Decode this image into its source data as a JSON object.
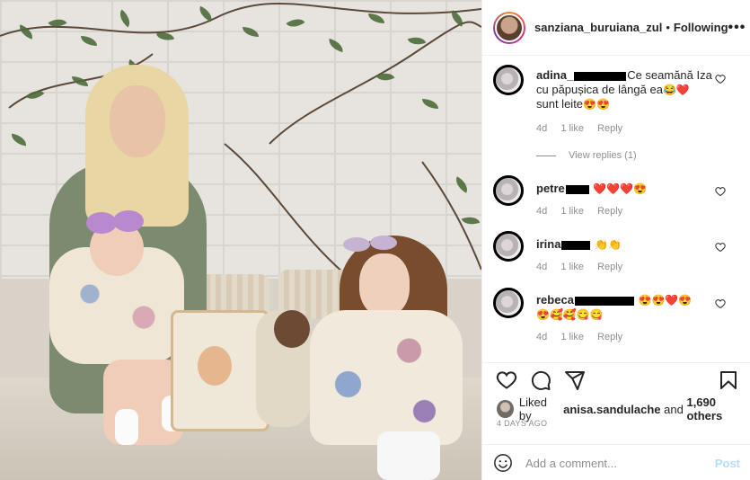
{
  "post": {
    "username": "sanziana_buruiana_zul",
    "separator": "•",
    "follow_status": "Following",
    "more_label": "•••"
  },
  "comments": [
    {
      "user": "adina_",
      "text_line1": "Ce seamănă Iza",
      "text_line2": "cu păpușica de lângă ea",
      "emoji_line2": "😂❤️",
      "text_line3": "sunt leite",
      "emoji_line3": "😍😍",
      "age": "4d",
      "likes": "1 like",
      "reply": "Reply",
      "like_icon": "heart-outline-icon"
    },
    {
      "user": "petre",
      "text": "",
      "emoji": "❤️❤️❤️😍",
      "age": "4d",
      "likes": "1 like",
      "reply": "Reply",
      "like_icon": "heart-outline-icon"
    },
    {
      "user": "irina",
      "text": "",
      "emoji": "👏👏",
      "age": "4d",
      "likes": "1 like",
      "reply": "Reply",
      "like_icon": "heart-outline-icon"
    },
    {
      "user": "rebeca",
      "emoji_line1": "😍😍❤️😍",
      "emoji_line2": "😍🥰🥰😋😋",
      "age": "4d",
      "likes": "1 like",
      "reply": "Reply",
      "like_icon": "heart-outline-icon"
    }
  ],
  "view_replies": "View replies (1)",
  "actions": {
    "like_icon": "heart-icon",
    "comment_icon": "comment-icon",
    "share_icon": "share-icon",
    "save_icon": "bookmark-icon"
  },
  "likes": {
    "prefix": "Liked by",
    "user": "anisa.sandulache",
    "middle": "and",
    "others": "1,690 others"
  },
  "timestamp": "4 DAYS AGO",
  "add_comment": {
    "placeholder": "Add a comment...",
    "post_label": "Post"
  },
  "colors": {
    "text": "#262626",
    "muted": "#8e8e8e",
    "post_disabled": "#b2dffc",
    "border": "#efefef"
  }
}
